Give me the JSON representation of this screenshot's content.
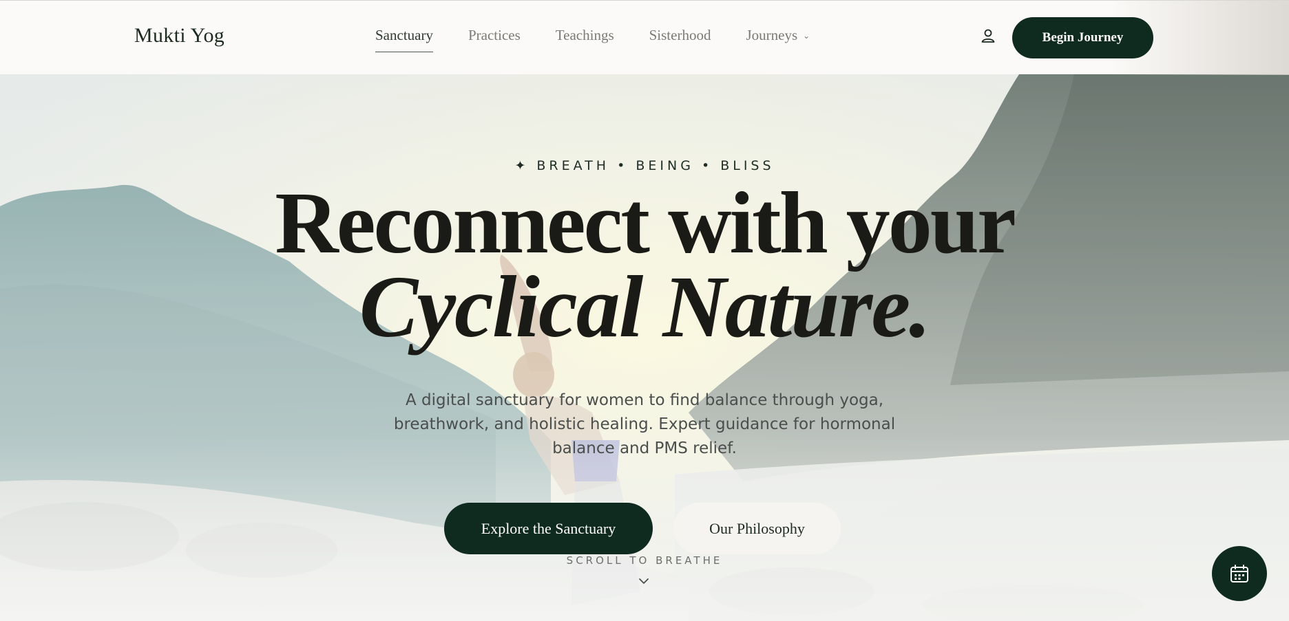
{
  "header": {
    "brand": "Mukti Yog",
    "nav": [
      {
        "label": "Sanctuary",
        "active": true
      },
      {
        "label": "Practices",
        "active": false
      },
      {
        "label": "Teachings",
        "active": false
      },
      {
        "label": "Sisterhood",
        "active": false
      },
      {
        "label": "Journeys",
        "active": false,
        "has_dropdown": true
      }
    ],
    "account_icon": "user-icon",
    "cta_label": "Begin Journey"
  },
  "hero": {
    "tagline": "✦ BREATH • BEING • BLISS",
    "headline_line1": "Reconnect with your",
    "headline_line2": "Cyclical Nature.",
    "subtitle": "A digital sanctuary for women to find balance through yoga, breathwork, and holistic healing. Expert guidance for hormonal balance and PMS relief.",
    "primary_cta": "Explore the Sanctuary",
    "secondary_cta": "Our Philosophy",
    "scroll_hint": "SCROLL TO BREATHE",
    "scroll_icon": "chevron-down-icon"
  },
  "floating_action": {
    "icon": "calendar-icon"
  },
  "colors": {
    "primary": "#0f2a1f",
    "text_dark": "#1a1a16",
    "text_muted": "#4a4e4c",
    "header_bg": "#fcfaf8"
  }
}
